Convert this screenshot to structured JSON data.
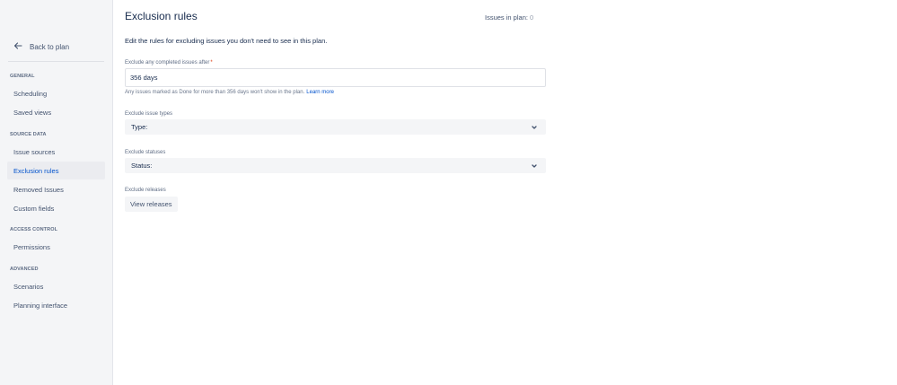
{
  "sidebar": {
    "back_label": "Back to plan",
    "sections": {
      "general": "GENERAL",
      "source_data": "SOURCE DATA",
      "access_control": "ACCESS CONTROL",
      "advanced": "ADVANCED"
    },
    "items": {
      "scheduling": "Scheduling",
      "saved_views": "Saved views",
      "issue_sources": "Issue sources",
      "exclusion_rules": "Exclusion rules",
      "removed_issues": "Removed Issues",
      "custom_fields": "Custom fields",
      "permissions": "Permissions",
      "scenarios": "Scenarios",
      "planning_interface": "Planning interface"
    },
    "active_item": "Exclusion rules"
  },
  "header": {
    "title": "Exclusion rules",
    "issues_label": "Issues in plan:",
    "issues_count": "0",
    "description": "Edit the rules for excluding issues you don't need to see in this plan."
  },
  "form": {
    "completed": {
      "label": "Exclude any completed issues after",
      "required_mark": "*",
      "value": "356 days",
      "helper": "Any issues marked as Done for more than 356 days won't show in the plan.",
      "learn_more": "Learn more"
    },
    "issue_types": {
      "label": "Exclude issue types",
      "select_text": "Type:"
    },
    "statuses": {
      "label": "Exclude statuses",
      "select_text": "Status:"
    },
    "releases": {
      "label": "Exclude releases",
      "button": "View releases"
    }
  },
  "colors": {
    "accent": "#0052cc",
    "sidebar_bg": "#f4f5f7",
    "required": "#de350b"
  }
}
